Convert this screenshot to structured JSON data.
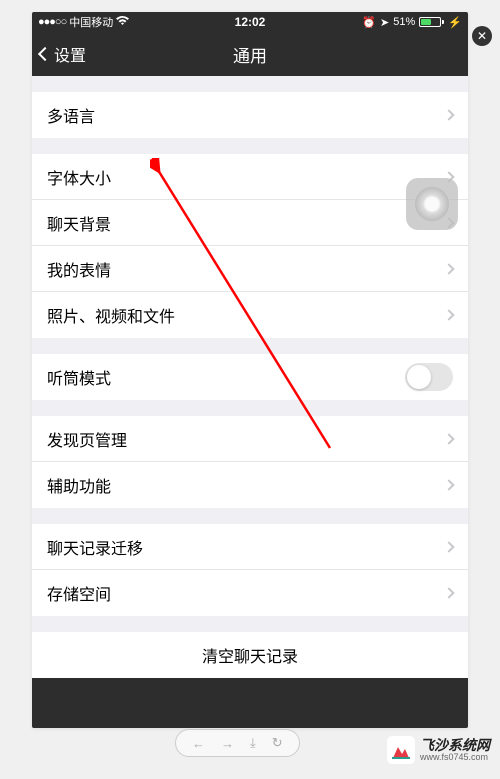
{
  "status": {
    "carrier": "中国移动",
    "time": "12:02",
    "battery": "51%"
  },
  "nav": {
    "back": "设置",
    "title": "通用"
  },
  "rows": {
    "multilang": "多语言",
    "fontsize": "字体大小",
    "chatbg": "聊天背景",
    "stickers": "我的表情",
    "media": "照片、视频和文件",
    "earmode": "听筒模式",
    "discover": "发现页管理",
    "accessibility": "辅助功能",
    "migrate": "聊天记录迁移",
    "storage": "存储空间",
    "clear": "清空聊天记录"
  },
  "watermark": {
    "line1": "飞沙系统网",
    "line2": "www.fs0745.com"
  }
}
